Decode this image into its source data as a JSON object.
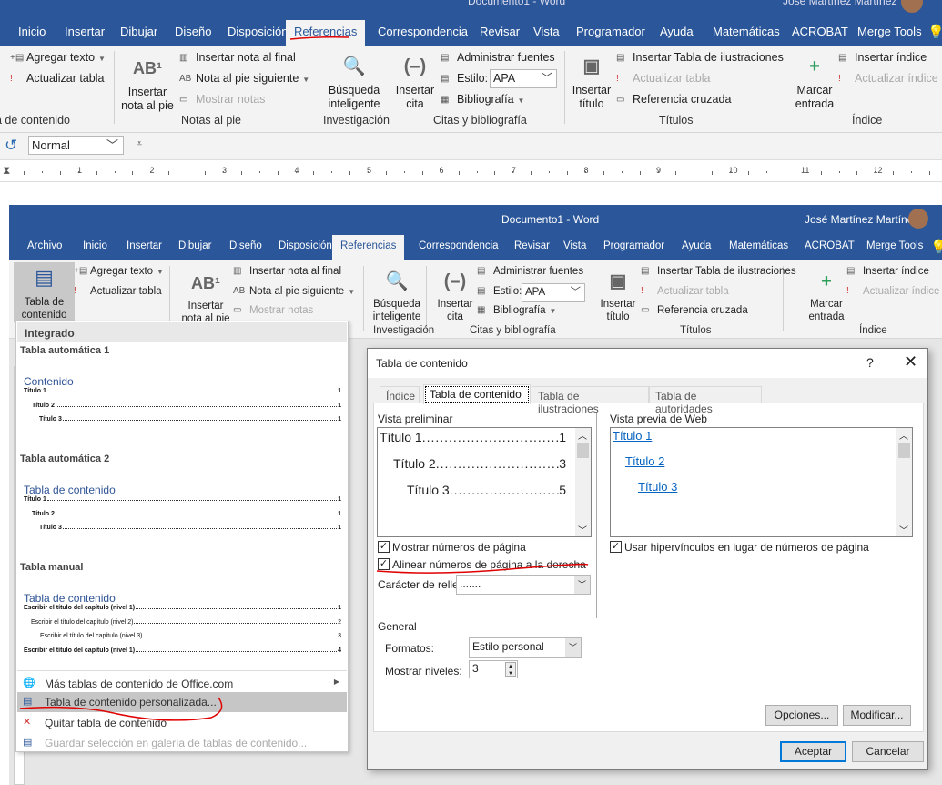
{
  "window": {
    "title": "Documento1  -  Word",
    "user": "José Martínez Martínez"
  },
  "tabs": [
    "Archivo",
    "Inicio",
    "Insertar",
    "Dibujar",
    "Diseño",
    "Disposición",
    "Referencias",
    "Correspondencia",
    "Revisar",
    "Vista",
    "Programador",
    "Ayuda",
    "Matemáticas",
    "ACROBAT",
    "Merge Tools"
  ],
  "active_tab": "Referencias",
  "ribbon": {
    "toc_button": "Tabla de contenido",
    "add_text": "Agregar texto",
    "update_table": "Actualizar tabla",
    "insert_footnote": "Insertar nota al pie",
    "insert_endnote": "Insertar nota al final",
    "next_footnote": "Nota al pie siguiente",
    "show_notes": "Mostrar notas",
    "smart_lookup": "Búsqueda inteligente",
    "insert_citation": "Insertar cita",
    "manage_sources": "Administrar fuentes",
    "style_label": "Estilo:",
    "style_value": "APA",
    "bibliography": "Bibliografía",
    "insert_caption": "Insertar título",
    "insert_table_figures": "Insertar Tabla de ilustraciones",
    "update_table_figures": "Actualizar tabla",
    "cross_reference": "Referencia cruzada",
    "mark_entry": "Marcar entrada",
    "insert_index": "Insertar índice",
    "update_index": "Actualizar índice",
    "groups": {
      "toc": "Tabla de contenido",
      "footnotes": "Notas al pie",
      "research": "Investigación",
      "citations": "Citas y bibliografía",
      "captions": "Títulos",
      "index": "Índice"
    }
  },
  "quick_bar": {
    "style_value": "Normal"
  },
  "ruler": [
    "1",
    "2",
    "3",
    "4",
    "5",
    "6",
    "7",
    "8",
    "9",
    "10",
    "11",
    "12",
    "13"
  ],
  "toc_menu": {
    "header": "Integrado",
    "auto1": {
      "name": "Tabla automática 1",
      "heading": "Contenido",
      "entries": [
        [
          "Título 1",
          "1"
        ],
        [
          "Título 2",
          "1"
        ],
        [
          "Título 3",
          "1"
        ]
      ]
    },
    "auto2": {
      "name": "Tabla automática 2",
      "heading": "Tabla de contenido",
      "entries": [
        [
          "Título 1",
          "1"
        ],
        [
          "Título 2",
          "1"
        ],
        [
          "Título 3",
          "1"
        ]
      ]
    },
    "manual": {
      "name": "Tabla manual",
      "heading": "Tabla de contenido",
      "entries": [
        [
          "Escribir el título del capítulo (nivel 1)",
          "1"
        ],
        [
          "Escribir el título del capítulo (nivel 2)",
          "2"
        ],
        [
          "Escribir el título del capítulo (nivel 3)",
          "3"
        ],
        [
          "Escribir el título del capítulo (nivel 1)",
          "4"
        ]
      ]
    },
    "more": "Más tablas de contenido de Office.com",
    "custom": "Tabla de contenido personalizada...",
    "remove": "Quitar tabla de contenido",
    "save": "Guardar selección en galería de tablas de contenido..."
  },
  "dialog": {
    "title": "Tabla de contenido",
    "help": "?",
    "tabs": [
      "Índice",
      "Tabla de contenido",
      "Tabla de ilustraciones",
      "Tabla de autoridades"
    ],
    "print_preview_label": "Vista preliminar",
    "print_preview": [
      [
        "Título 1",
        "1"
      ],
      [
        "Título 2",
        "3"
      ],
      [
        "Título 3",
        "5"
      ]
    ],
    "web_preview_label": "Vista previa de Web",
    "web_preview": [
      "Título 1",
      "Título 2",
      "Título 3"
    ],
    "show_page_numbers": {
      "label": "Mostrar números de página",
      "checked": true
    },
    "right_align": {
      "label": "Alinear números de página a la derecha",
      "checked": true
    },
    "use_hyperlinks": {
      "label": "Usar hipervínculos en lugar de números de página",
      "checked": true
    },
    "tab_leader_label": "Carácter de relleno:",
    "tab_leader_value": ".......",
    "general_label": "General",
    "formats_label": "Formatos:",
    "formats_value": "Estilo personal",
    "levels_label": "Mostrar niveles:",
    "levels_value": "3",
    "options_button": "Opciones...",
    "modify_button": "Modificar...",
    "ok_button": "Aceptar",
    "cancel_button": "Cancelar"
  },
  "colors": {
    "word_blue": "#2b579a",
    "annotation_red": "#e00000",
    "link": "#0563c1"
  }
}
